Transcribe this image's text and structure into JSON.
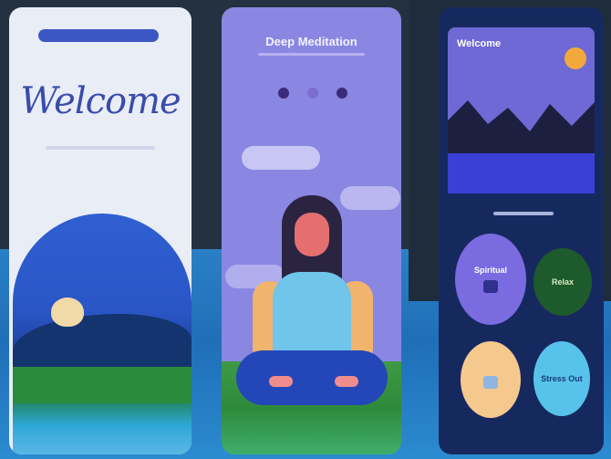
{
  "screen_1": {
    "welcome_text": "Welcome"
  },
  "screen_2": {
    "title": "Deep Meditation",
    "pager": {
      "pages": 3,
      "active": 2
    }
  },
  "screen_3": {
    "hero_title": "Welcome",
    "cards": [
      {
        "label": "Spiritual",
        "icon": "yoga-icon"
      },
      {
        "label": "Relax",
        "icon": ""
      },
      {
        "label": "",
        "icon": "image-icon"
      },
      {
        "label": "Stress Out",
        "icon": ""
      }
    ]
  },
  "colors": {
    "accent_blue": "#3c57c4",
    "lavender": "#8a87e2",
    "navy": "#16295f",
    "sun": "#f2a93c"
  }
}
